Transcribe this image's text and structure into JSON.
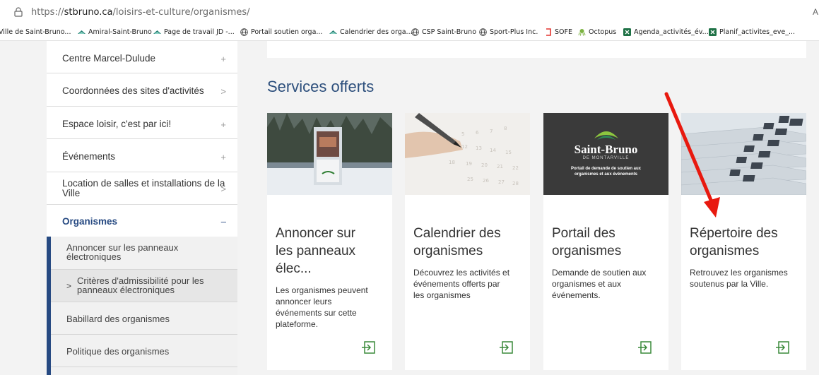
{
  "browser": {
    "url_prefix": "https://",
    "url_host": "stbruno.ca",
    "url_path": "/loisirs-et-culture/organismes/",
    "right_glyph": "A"
  },
  "bookmarks": [
    {
      "label": "Ville de Saint-Bruno...",
      "icon": "none"
    },
    {
      "label": "Amiral-Saint-Bruno",
      "icon": "wave-icon"
    },
    {
      "label": "Page de travail JD -...",
      "icon": "wave-icon"
    },
    {
      "label": "Portail soutien orga...",
      "icon": "globe-icon"
    },
    {
      "label": "Calendrier des orga...",
      "icon": "wave-icon"
    },
    {
      "label": "CSP Saint-Bruno",
      "icon": "globe-icon"
    },
    {
      "label": "Sport-Plus Inc.",
      "icon": "globe-icon"
    },
    {
      "label": "SOFE",
      "icon": "sofe-icon"
    },
    {
      "label": "Octopus",
      "icon": "octopus-icon"
    },
    {
      "label": "Agenda_activités_év...",
      "icon": "excel-icon"
    },
    {
      "label": "Planif_activites_eve_...",
      "icon": "excel-icon"
    }
  ],
  "nav": {
    "items": [
      {
        "label": "Centre Marcel-Dulude",
        "sign": "+"
      },
      {
        "label": "Coordonnées des sites d'activités",
        "sign": ">"
      },
      {
        "label": "Espace loisir, c'est par ici!",
        "sign": "+"
      },
      {
        "label": "Événements",
        "sign": "+"
      },
      {
        "label_line1": "Location de salles et installations de la",
        "label_line2": "Ville",
        "sign": ">"
      },
      {
        "label": "Organismes",
        "sign": "–"
      }
    ],
    "sub_items": [
      {
        "line1": "Annoncer sur les panneaux",
        "line2": "électroniques"
      },
      {
        "prefix": ">",
        "line1": "Critères d'admissibilité pour les",
        "line2": "panneaux électroniques"
      },
      {
        "line1": "Babillard des organismes"
      },
      {
        "line1": "Politique des organismes"
      }
    ]
  },
  "main": {
    "section_title": "Services offerts",
    "cards": [
      {
        "title_l1": "Annoncer sur",
        "title_l2": "les panneaux",
        "title_l3": "élec...",
        "desc": [
          "Les organismes peuvent",
          "annoncer leurs",
          "événements sur cette",
          "plateforme."
        ]
      },
      {
        "title_l1": "Calendrier des",
        "title_l2": "organismes",
        "desc": [
          "Découvrez les activités et",
          "événements offerts par",
          "les organismes"
        ]
      },
      {
        "title_l1": "Portail des",
        "title_l2": "organismes",
        "desc": [
          "Demande de soutien aux",
          "organismes et aux",
          "événements."
        ],
        "logo_name": "Saint-Bruno",
        "logo_sub": "DE MONTARVILLE",
        "logo_caption_1": "Portail de demande de soutien aux",
        "logo_caption_2": "organismes et aux événements"
      },
      {
        "title_l1": "Répertoire des",
        "title_l2": "organismes",
        "desc": [
          "Retrouvez les organismes",
          "soutenus par la Ville."
        ]
      }
    ]
  },
  "colors": {
    "accent_blue": "#2d4f7c",
    "nav_bar": "#274a82",
    "link_green": "#3a8a3a",
    "annotation_red": "#e8190f"
  }
}
